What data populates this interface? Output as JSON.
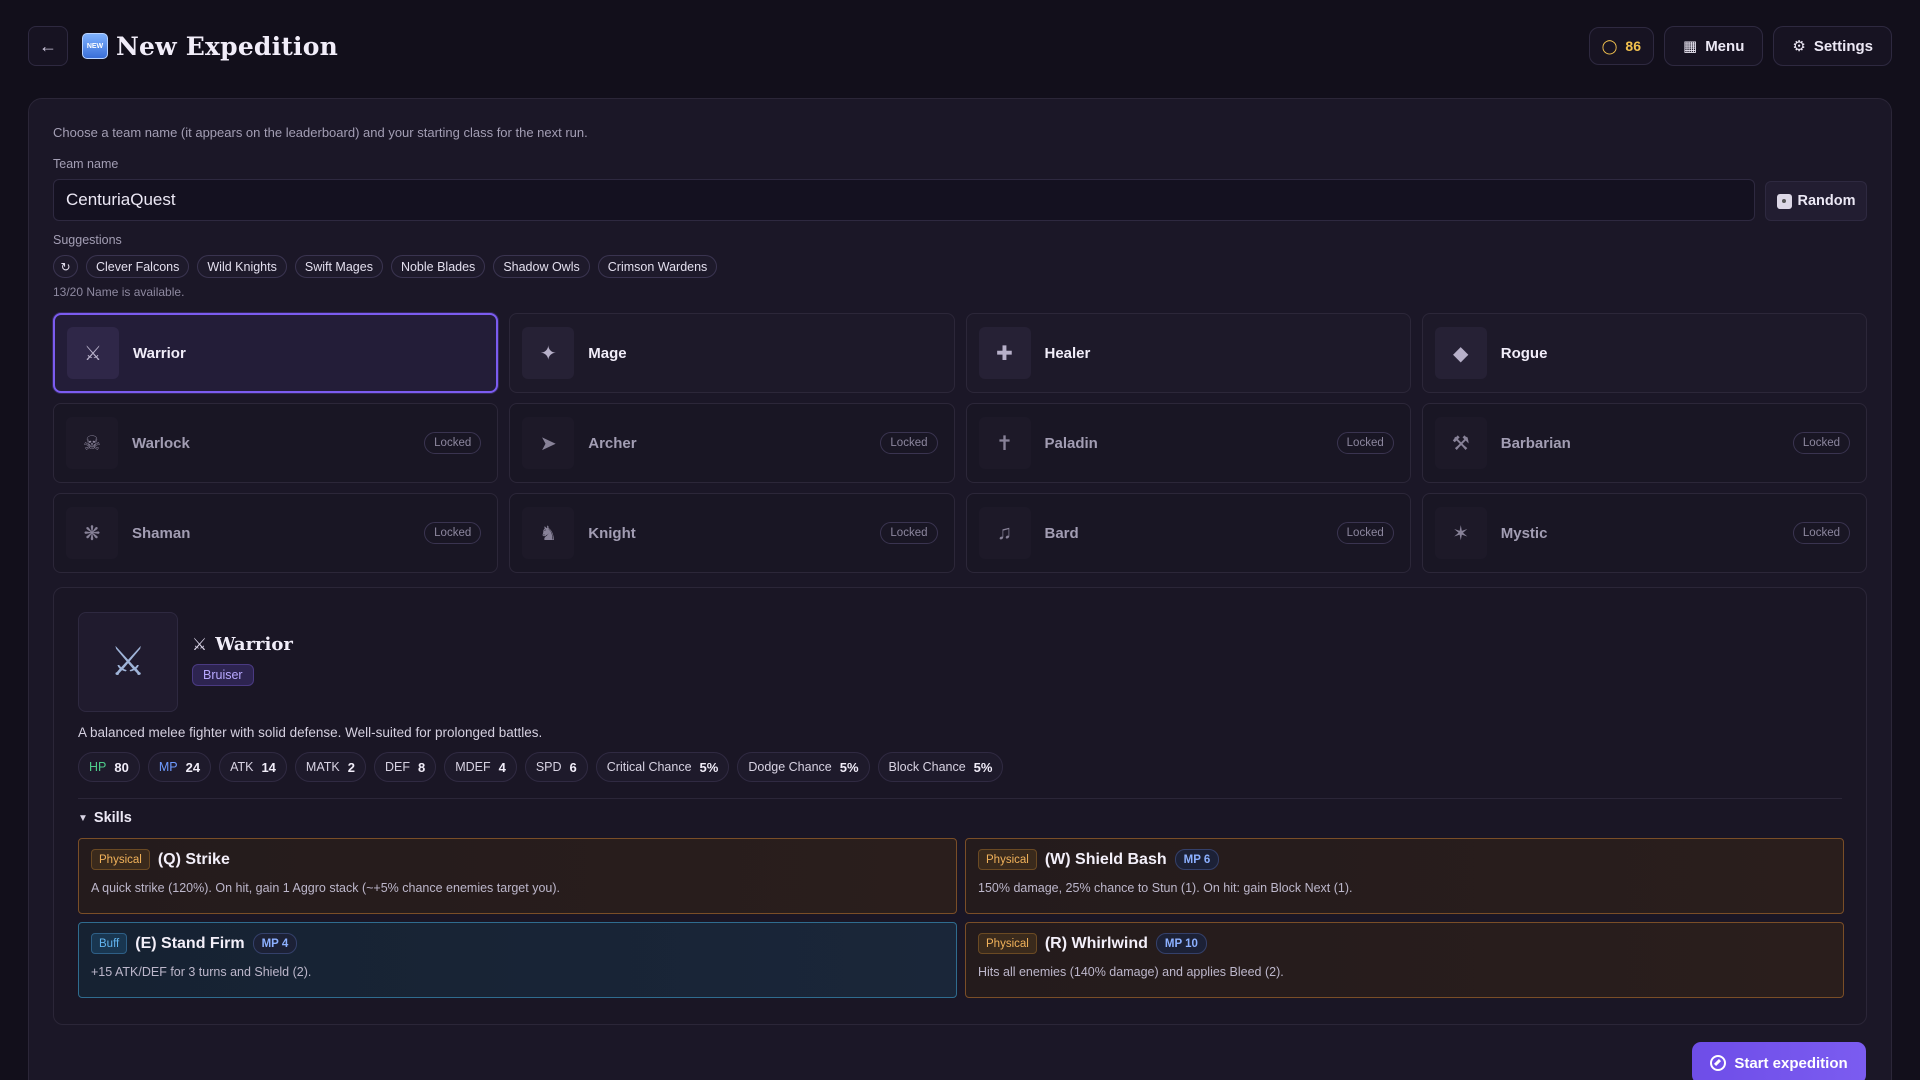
{
  "header": {
    "title": "New Expedition",
    "new_badge": "NEW",
    "coins": "86",
    "menu_label": "Menu",
    "settings_label": "Settings"
  },
  "form": {
    "intro": "Choose a team name (it appears on the leaderboard) and your starting class for the next run.",
    "team_label": "Team name",
    "team_value": "CenturiaQuest",
    "random_label": "Random",
    "suggestions_label": "Suggestions",
    "suggestions": [
      "Clever Falcons",
      "Wild Knights",
      "Swift Mages",
      "Noble Blades",
      "Shadow Owls",
      "Crimson Wardens"
    ],
    "availability": "13/20 Name is available."
  },
  "classes": [
    {
      "name": "Warrior",
      "locked": false,
      "selected": true
    },
    {
      "name": "Mage",
      "locked": false
    },
    {
      "name": "Healer",
      "locked": false
    },
    {
      "name": "Rogue",
      "locked": false
    },
    {
      "name": "Warlock",
      "locked": true
    },
    {
      "name": "Archer",
      "locked": true
    },
    {
      "name": "Paladin",
      "locked": true
    },
    {
      "name": "Barbarian",
      "locked": true
    },
    {
      "name": "Shaman",
      "locked": true
    },
    {
      "name": "Knight",
      "locked": true
    },
    {
      "name": "Bard",
      "locked": true
    },
    {
      "name": "Mystic",
      "locked": true
    }
  ],
  "locked_label": "Locked",
  "detail": {
    "name": "Warrior",
    "role": "Bruiser",
    "description": "A balanced melee fighter with solid defense. Well-suited for prolonged battles.",
    "stats": [
      {
        "key": "HP",
        "value": "80"
      },
      {
        "key": "MP",
        "value": "24"
      },
      {
        "key": "ATK",
        "value": "14"
      },
      {
        "key": "MATK",
        "value": "2"
      },
      {
        "key": "DEF",
        "value": "8"
      },
      {
        "key": "MDEF",
        "value": "4"
      },
      {
        "key": "SPD",
        "value": "6"
      },
      {
        "key": "Critical Chance",
        "value": "5%"
      },
      {
        "key": "Dodge Chance",
        "value": "5%"
      },
      {
        "key": "Block Chance",
        "value": "5%"
      }
    ],
    "skills_label": "Skills",
    "skills": [
      {
        "type": "Physical",
        "name": "(Q) Strike",
        "mp": "",
        "desc": "A quick strike (120%). On hit, gain 1 Aggro stack (~+5% chance enemies target you)."
      },
      {
        "type": "Physical",
        "name": "(W) Shield Bash",
        "mp": "MP 6",
        "desc": "150% damage, 25% chance to Stun (1). On hit: gain Block Next (1)."
      },
      {
        "type": "Buff",
        "name": "(E) Stand Firm",
        "mp": "MP 4",
        "desc": "+15 ATK/DEF for 3 turns and Shield (2)."
      },
      {
        "type": "Physical",
        "name": "(R) Whirlwind",
        "mp": "MP 10",
        "desc": "Hits all enemies (140% damage) and applies Bleed (2)."
      }
    ]
  },
  "start_label": "Start expedition",
  "colors": {
    "accent": "#7b5cf0",
    "coin": "#f2c14e",
    "hp": "#4ecb8a",
    "mp": "#6f9bff",
    "physical": "#f0b15a",
    "buff": "#62b5f0"
  },
  "icons": {
    "back": "arrow-left-icon",
    "coin": "coin-icon",
    "menu": "grid-icon",
    "settings": "gear-icon",
    "random": "dice-icon",
    "refresh": "refresh-icon",
    "start": "compass-icon"
  }
}
